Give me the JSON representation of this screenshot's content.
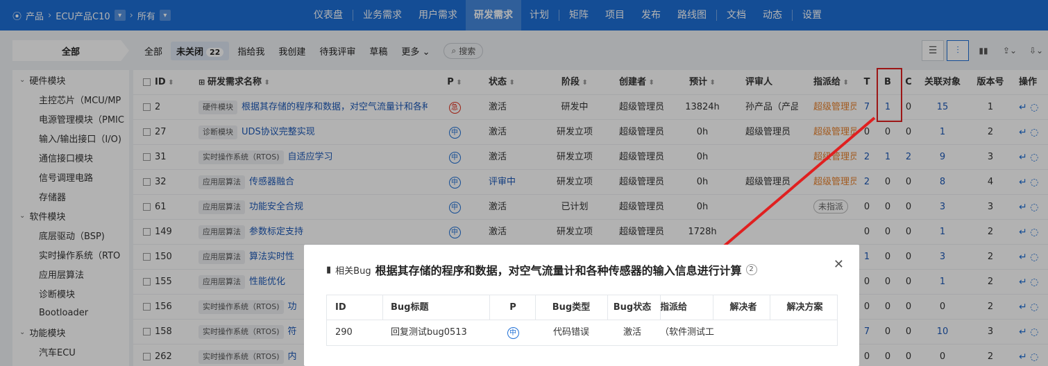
{
  "topbar": {
    "breadcrumb": [
      "产品",
      "ECU产品C10",
      "所有"
    ],
    "nav": [
      "仪表盘",
      "业务需求",
      "用户需求",
      "研发需求",
      "计划",
      "矩阵",
      "项目",
      "发布",
      "路线图",
      "文档",
      "动态",
      "设置"
    ],
    "active_nav": "研发需求"
  },
  "filter": {
    "all_label": "全部",
    "tabs": [
      "全部",
      "未关闭",
      "指给我",
      "我创建",
      "待我评审",
      "草稿",
      "更多"
    ],
    "active_tab": "未关闭",
    "active_count": "22",
    "search_label": "搜索"
  },
  "sidebar": [
    {
      "type": "group",
      "label": "硬件模块"
    },
    {
      "type": "child",
      "label": "主控芯片（MCU/MP"
    },
    {
      "type": "child",
      "label": "电源管理模块（PMIC"
    },
    {
      "type": "child",
      "label": "输入/输出接口（I/O)"
    },
    {
      "type": "child",
      "label": "通信接口模块"
    },
    {
      "type": "child",
      "label": "信号调理电路"
    },
    {
      "type": "child",
      "label": "存储器"
    },
    {
      "type": "group",
      "label": "软件模块"
    },
    {
      "type": "child",
      "label": "底层驱动（BSP)"
    },
    {
      "type": "child",
      "label": "实时操作系统（RTO"
    },
    {
      "type": "child",
      "label": "应用层算法"
    },
    {
      "type": "child",
      "label": "诊断模块"
    },
    {
      "type": "child",
      "label": "Bootloader"
    },
    {
      "type": "group",
      "label": "功能模块"
    },
    {
      "type": "child",
      "label": "汽车ECU"
    }
  ],
  "table": {
    "headers": [
      "ID",
      "研发需求名称",
      "P",
      "状态",
      "阶段",
      "创建者",
      "预计",
      "评审人",
      "指派给",
      "T",
      "B",
      "C",
      "关联对象",
      "版本号",
      "操作"
    ],
    "rows": [
      {
        "id": "2",
        "tag": "硬件模块",
        "title": "根据其存储的程序和数据，对空气流量计和各种",
        "p": "急",
        "status": "激活",
        "stage": "研发中",
        "creator": "超级管理员",
        "est": "13824h",
        "reviewer": "孙产品（产品",
        "assignee": "超级管理员",
        "t": "7",
        "b": "1",
        "c": "0",
        "rel": "15",
        "ver": "1"
      },
      {
        "id": "27",
        "tag": "诊断模块",
        "title": "UDS协议完整实现",
        "p": "中",
        "status": "激活",
        "stage": "研发立项",
        "creator": "超级管理员",
        "est": "0h",
        "reviewer": "超级管理员",
        "assignee": "超级管理员",
        "t": "0",
        "b": "0",
        "c": "0",
        "rel": "1",
        "ver": "2"
      },
      {
        "id": "31",
        "tag": "实时操作系统（RTOS)",
        "title": "自适应学习",
        "p": "中",
        "status": "激活",
        "stage": "研发立项",
        "creator": "超级管理员",
        "est": "0h",
        "reviewer": "",
        "assignee": "超级管理员",
        "t": "2",
        "b": "1",
        "c": "2",
        "rel": "9",
        "ver": "3"
      },
      {
        "id": "32",
        "tag": "应用层算法",
        "title": "传感器融合",
        "p": "中",
        "status": "评审中",
        "stage": "研发立项",
        "creator": "超级管理员",
        "est": "0h",
        "reviewer": "超级管理员",
        "assignee": "超级管理员",
        "t": "2",
        "b": "0",
        "c": "0",
        "rel": "8",
        "ver": "4"
      },
      {
        "id": "61",
        "tag": "应用层算法",
        "title": "功能安全合规",
        "p": "中",
        "status": "激活",
        "stage": "已计划",
        "creator": "超级管理员",
        "est": "0h",
        "reviewer": "",
        "assignee": "未指派",
        "t": "0",
        "b": "0",
        "c": "0",
        "rel": "3",
        "ver": "3"
      },
      {
        "id": "149",
        "tag": "应用层算法",
        "title": "参数标定支持",
        "p": "中",
        "status": "激活",
        "stage": "研发立项",
        "creator": "超级管理员",
        "est": "1728h",
        "reviewer": "",
        "assignee": "",
        "t": "0",
        "b": "0",
        "c": "0",
        "rel": "1",
        "ver": "2"
      },
      {
        "id": "150",
        "tag": "应用层算法",
        "title": "算法实时性",
        "p": "中",
        "status": "",
        "stage": "",
        "creator": "",
        "est": "",
        "reviewer": "",
        "assignee": "",
        "t": "1",
        "b": "0",
        "c": "0",
        "rel": "3",
        "ver": "2"
      },
      {
        "id": "155",
        "tag": "应用层算法",
        "title": "性能优化",
        "p": "中",
        "status": "",
        "stage": "",
        "creator": "",
        "est": "",
        "reviewer": "",
        "assignee": "",
        "t": "0",
        "b": "0",
        "c": "0",
        "rel": "1",
        "ver": "2"
      },
      {
        "id": "156",
        "tag": "实时操作系统（RTOS)",
        "title": "功",
        "p": "中",
        "status": "",
        "stage": "",
        "creator": "",
        "est": "",
        "reviewer": "",
        "assignee": "",
        "t": "0",
        "b": "0",
        "c": "0",
        "rel": "0",
        "ver": "2"
      },
      {
        "id": "158",
        "tag": "实时操作系统（RTOS)",
        "title": "符",
        "p": "中",
        "status": "",
        "stage": "",
        "creator": "",
        "est": "",
        "reviewer": "",
        "assignee": "",
        "t": "7",
        "b": "0",
        "c": "0",
        "rel": "10",
        "ver": "3"
      },
      {
        "id": "262",
        "tag": "实时操作系统（RTOS)",
        "title": "内",
        "p": "中",
        "status": "",
        "stage": "",
        "creator": "",
        "est": "",
        "reviewer": "",
        "assignee": "",
        "t": "0",
        "b": "0",
        "c": "0",
        "rel": "0",
        "ver": "2"
      }
    ]
  },
  "modal": {
    "label": "相关Bug",
    "title": "根据其存储的程序和数据，对空气流量计和各种传感器的输入信息进行计算",
    "count": "2",
    "headers": [
      "ID",
      "Bug标题",
      "P",
      "Bug类型",
      "Bug状态",
      "指派给",
      "解决者",
      "解决方案"
    ],
    "rows": [
      {
        "id": "290",
        "title": "回复测试bug0513",
        "p": "中",
        "type": "代码错误",
        "status": "激活",
        "assignee": "（软件测试工",
        "resolver": "",
        "resolution": ""
      }
    ]
  },
  "colors": {
    "primary": "#1e6fd6",
    "highlight_red": "#e02020",
    "assignee_orange": "#e8832f"
  },
  "icons": [
    "location-icon",
    "chevron-right-icon",
    "chevron-down-icon",
    "search-icon",
    "list-view-icon",
    "tree-view-icon",
    "bar-chart-icon",
    "export-icon",
    "import-icon",
    "close-icon",
    "sort-icon"
  ]
}
